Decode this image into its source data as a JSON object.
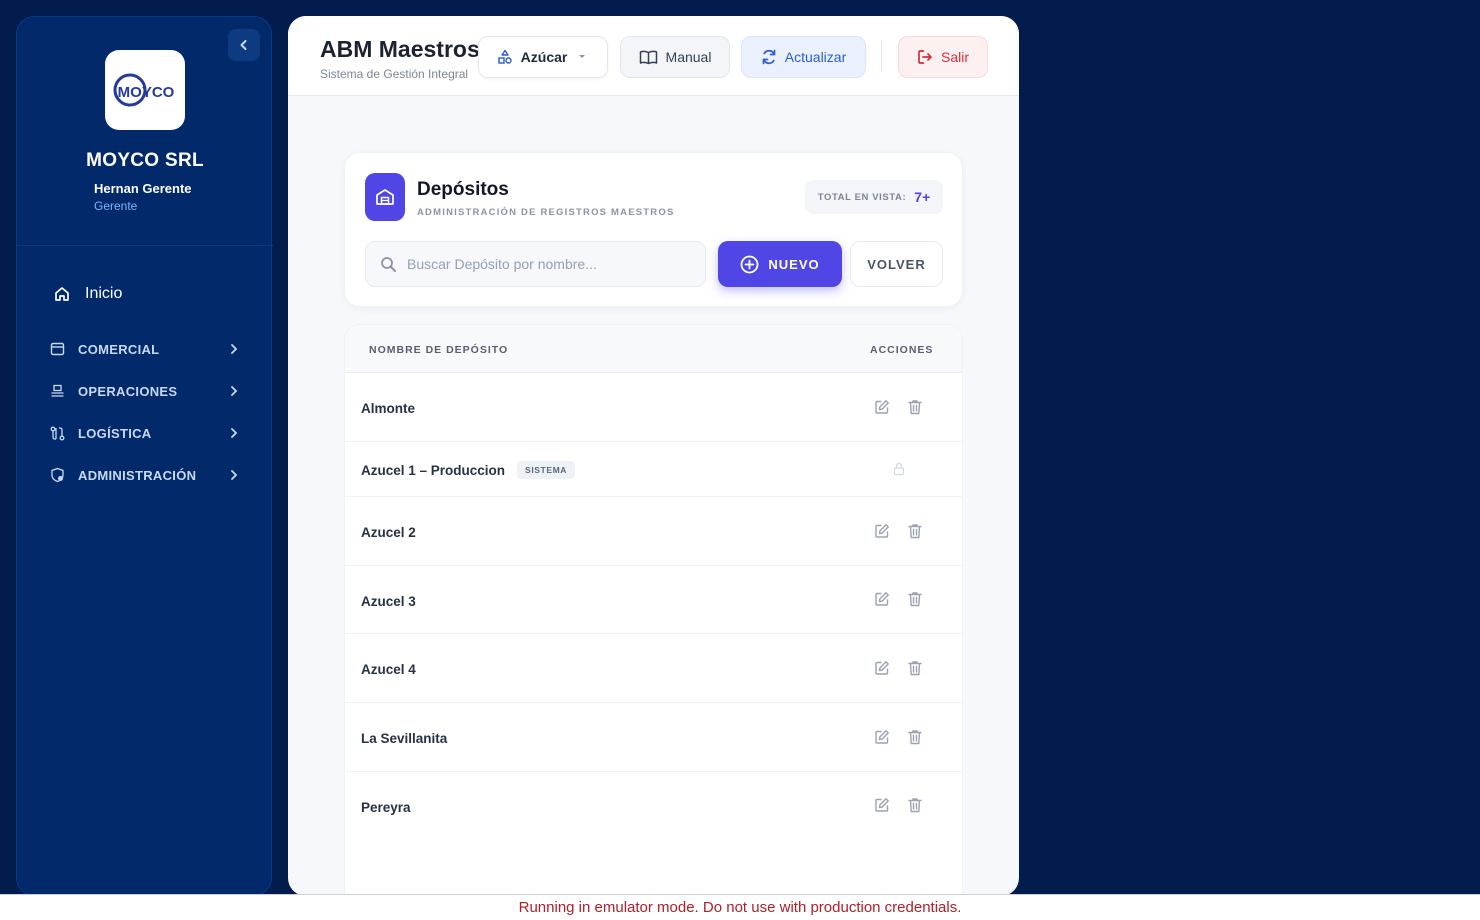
{
  "sidebar": {
    "company": "MOYCO SRL",
    "user_name": "Hernan Gerente",
    "user_role": "Gerente",
    "logo_text": "MOYCO",
    "home_label": "Inicio",
    "groups": [
      {
        "label": "COMERCIAL",
        "icon": "store-icon"
      },
      {
        "label": "OPERACIONES",
        "icon": "conveyor-icon"
      },
      {
        "label": "LOGÍSTICA",
        "icon": "route-icon"
      },
      {
        "label": "ADMINISTRACIÓN",
        "icon": "shield-gear-icon"
      }
    ]
  },
  "topbar": {
    "title": "ABM Maestros",
    "subtitle": "Sistema de Gestión Integral",
    "select_label": "Azúcar",
    "manual_label": "Manual",
    "update_label": "Actualizar",
    "exit_label": "Salir"
  },
  "card": {
    "title": "Depósitos",
    "subtitle": "ADMINISTRACIÓN DE REGISTROS MAESTROS",
    "total_label": "TOTAL EN VISTA:",
    "total_value": "7+",
    "search_placeholder": "Buscar Depósito por nombre...",
    "search_value": "",
    "new_label": "NUEVO",
    "back_label": "VOLVER"
  },
  "table": {
    "col_name": "NOMBRE DE DEPÓSITO",
    "col_actions": "ACCIONES",
    "rows": [
      {
        "name": "Almonte",
        "badge": "",
        "locked": false
      },
      {
        "name": "Azucel 1 – Produccion",
        "badge": "SISTEMA",
        "locked": true
      },
      {
        "name": "Azucel 2",
        "badge": "",
        "locked": false
      },
      {
        "name": "Azucel 3",
        "badge": "",
        "locked": false
      },
      {
        "name": "Azucel 4",
        "badge": "",
        "locked": false
      },
      {
        "name": "La Sevillanita",
        "badge": "",
        "locked": false
      },
      {
        "name": "Pereyra",
        "badge": "",
        "locked": false
      }
    ]
  },
  "banner": {
    "text": "Running in emulator mode. Do not use with production credentials."
  },
  "colors": {
    "background": "#021c4d",
    "sidebar": "#022a6b",
    "accent": "#4f46e5",
    "danger": "#d6303a",
    "update": "#2b5bd7"
  }
}
